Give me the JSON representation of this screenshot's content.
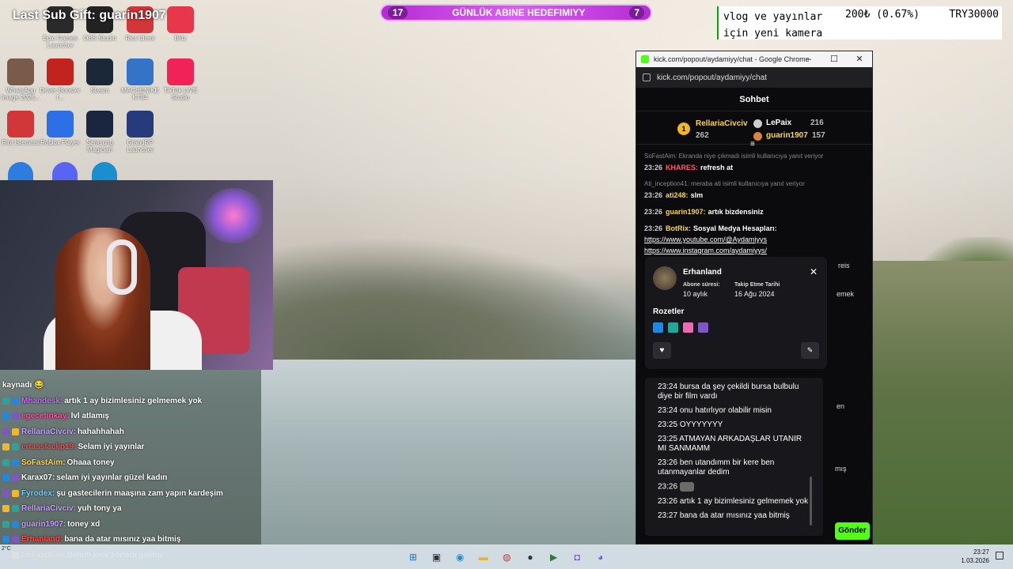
{
  "overlay": {
    "title": "Last Sub Gift: guarin1907"
  },
  "goal": {
    "left": "17",
    "label": "GÜNLÜK ABINE HEDEFIMIYY",
    "right": "7"
  },
  "donation": {
    "line1": "vlog ve yayınlar",
    "line2": "için yeni kamera",
    "amount": "200₺ (0.67%)",
    "target": "TRY30000"
  },
  "desktop_icons": [
    {
      "label": "Epic Games Launcher",
      "icon": "epic-games-icon",
      "color": "#2a2a2a"
    },
    {
      "label": "OBS Studio",
      "icon": "obs-icon",
      "color": "#222"
    },
    {
      "label": "Riot Client",
      "icon": "riot-client-icon",
      "color": "#d13639"
    },
    {
      "label": "Blitz",
      "icon": "blitz-icon",
      "color": "#e8364a"
    },
    {
      "label": "WhatsApp Image 2026...",
      "icon": "image-file-icon",
      "color": "#7a5a48"
    },
    {
      "label": "Driver Booster f...",
      "icon": "driver-booster-icon",
      "color": "#c3231f"
    },
    {
      "label": "Steam",
      "icon": "steam-icon",
      "color": "#1b2838"
    },
    {
      "label": "MACHENIKE KT84",
      "icon": "keyboard-icon",
      "color": "#3573c8"
    },
    {
      "label": "TikTok LIVE Studio",
      "icon": "tiktok-icon",
      "color": "#f02257"
    },
    {
      "label": "Riot İstemcisi",
      "icon": "riot-client-icon",
      "color": "#d13639"
    },
    {
      "label": "Roblox Player",
      "icon": "roblox-icon",
      "color": "#2c6fe6"
    },
    {
      "label": "Samsung Magician",
      "icon": "samsung-magician-icon",
      "color": "#1a2540"
    },
    {
      "label": "GrandRP Launcher",
      "icon": "grandrp-icon",
      "color": "#263a7c"
    }
  ],
  "stream_chat": [
    {
      "user": "",
      "text": "kaynadı 😂",
      "color": "#ffffff"
    },
    {
      "user": "Mhandesk:",
      "text": "artık 1 ay bizimlesiniz gelmemek yok",
      "color": "#c66cff"
    },
    {
      "user": "egecetinkay:",
      "text": "lvl atlamış",
      "color": "#ff4fa0"
    },
    {
      "user": "RellariaCivciv:",
      "text": "hahahhahah",
      "color": "#c6a0ff"
    },
    {
      "user": "ertasslaclip19:",
      "text": "Selam iyi yayınlar",
      "color": "#ff4a4a"
    },
    {
      "user": "SoFastAim:",
      "text": "Ohaaa toney",
      "color": "#ffd64a"
    },
    {
      "user": "Karax07:",
      "text": "selam iyi yayınlar güzel kadın",
      "color": "#ffffff"
    },
    {
      "user": "Fyrodex:",
      "text": "şu gastecilerin maaşına zam yapın kardeşim",
      "color": "#7ad0ff"
    },
    {
      "user": "RellariaCivciv:",
      "text": "yuh tony ya",
      "color": "#c6a0ff"
    },
    {
      "user": "guarin1907:",
      "text": "toney xd",
      "color": "#c6a0ff"
    },
    {
      "user": "Erhanland:",
      "text": "bana da atar mısınız yaa bitmiş",
      "color": "#ff4a4a"
    },
    {
      "user": "SoFastAim:",
      "text": "Benim kick zorladı galiba",
      "color": "#ffd64a"
    }
  ],
  "chrome": {
    "title": "kick.com/popout/aydamiyy/chat - Google Chrome",
    "url": "kick.com/popout/aydamiyy/chat",
    "min": "–",
    "max": "☐",
    "close": "✕"
  },
  "chat": {
    "header": "Sohbet",
    "leaders": [
      {
        "rank": "1",
        "name": "RellariaCivciv",
        "score": "262"
      },
      {
        "rank": "2",
        "name": "LePaix",
        "score": "216"
      },
      {
        "rank": "3",
        "name": "guarin1907",
        "score": "157"
      }
    ],
    "messages": [
      {
        "reply": "SoFastAim: Ekranda niye çıkmadı isimli kullanıcıya yanıt veriyor",
        "time": "23:26",
        "user": "KHARES:",
        "text": "refresh at",
        "color": "#ff5a6a"
      },
      {
        "reply": "Ati_inception41: meraba ati isimli kullanıcıya yanıt veriyor",
        "time": "23:26",
        "user": "ati248:",
        "text": "slm",
        "color": "#ffd64a"
      },
      {
        "reply": "",
        "time": "23:26",
        "user": "guarin1907:",
        "text": "artık bizdensiniz",
        "color": "#ffd64a"
      },
      {
        "reply": "",
        "time": "23:26",
        "user": "BotRix:",
        "text": "Sosyal Medya Hesapları:",
        "color": "#ffd64a"
      }
    ],
    "links": [
      "https://www.youtube.com/@Aydamiyys",
      "https://www.instagram.com/aydamiyys/"
    ],
    "behind": [
      "reis",
      "emek",
      "en",
      "mış"
    ],
    "send": "Gönder"
  },
  "user_card": {
    "name": "Erhanland",
    "sub_label": "Abone süresi:",
    "sub_value": "10 aylık",
    "follow_label": "Takip Etme Tarihi",
    "follow_value": "16 Ağu 2024",
    "badges_title": "Rozetler",
    "close": "✕",
    "heart": "♥",
    "pen": "✎"
  },
  "history": [
    {
      "time": "23:24",
      "text": "bursa da şey çekildi bursa bulbulu diye bir film vardı"
    },
    {
      "time": "23:24",
      "text": "onu hatırlıyor olabilir misin"
    },
    {
      "time": "23:25",
      "text": "OYYYYYYY"
    },
    {
      "time": "23:25",
      "text": "ATMAYAN ARKADAŞLAR UTANIR MI SANMAMM"
    },
    {
      "time": "23:26",
      "text": "ben utandımm bir kere ben utanmayanlar dedim"
    },
    {
      "time": "23:26",
      "text": ""
    },
    {
      "time": "23:26",
      "text": "artık 1 ay bizimlesiniz gelmemek yok"
    },
    {
      "time": "23:27",
      "text": "bana da atar mısınız yaa bitmiş"
    }
  ],
  "taskbar": {
    "weather": "2°C",
    "time": "23:27",
    "date": "1.03.2026",
    "apps": [
      {
        "name": "windows-start-icon",
        "glyph": "⊞",
        "color": "#1e6fd9"
      },
      {
        "name": "task-view-icon",
        "glyph": "▣",
        "color": "#333"
      },
      {
        "name": "edge-icon",
        "glyph": "◉",
        "color": "#1a8fd0"
      },
      {
        "name": "file-explorer-icon",
        "glyph": "▬",
        "color": "#e8b232"
      },
      {
        "name": "chrome-icon",
        "glyph": "◍",
        "color": "#d33"
      },
      {
        "name": "obs-icon",
        "glyph": "●",
        "color": "#333"
      },
      {
        "name": "terminal-icon",
        "glyph": "▶",
        "color": "#2e7d32"
      },
      {
        "name": "app-icon",
        "glyph": "◘",
        "color": "#7b4fc8"
      },
      {
        "name": "discord-icon",
        "glyph": "◕",
        "color": "#5865f2"
      }
    ]
  }
}
